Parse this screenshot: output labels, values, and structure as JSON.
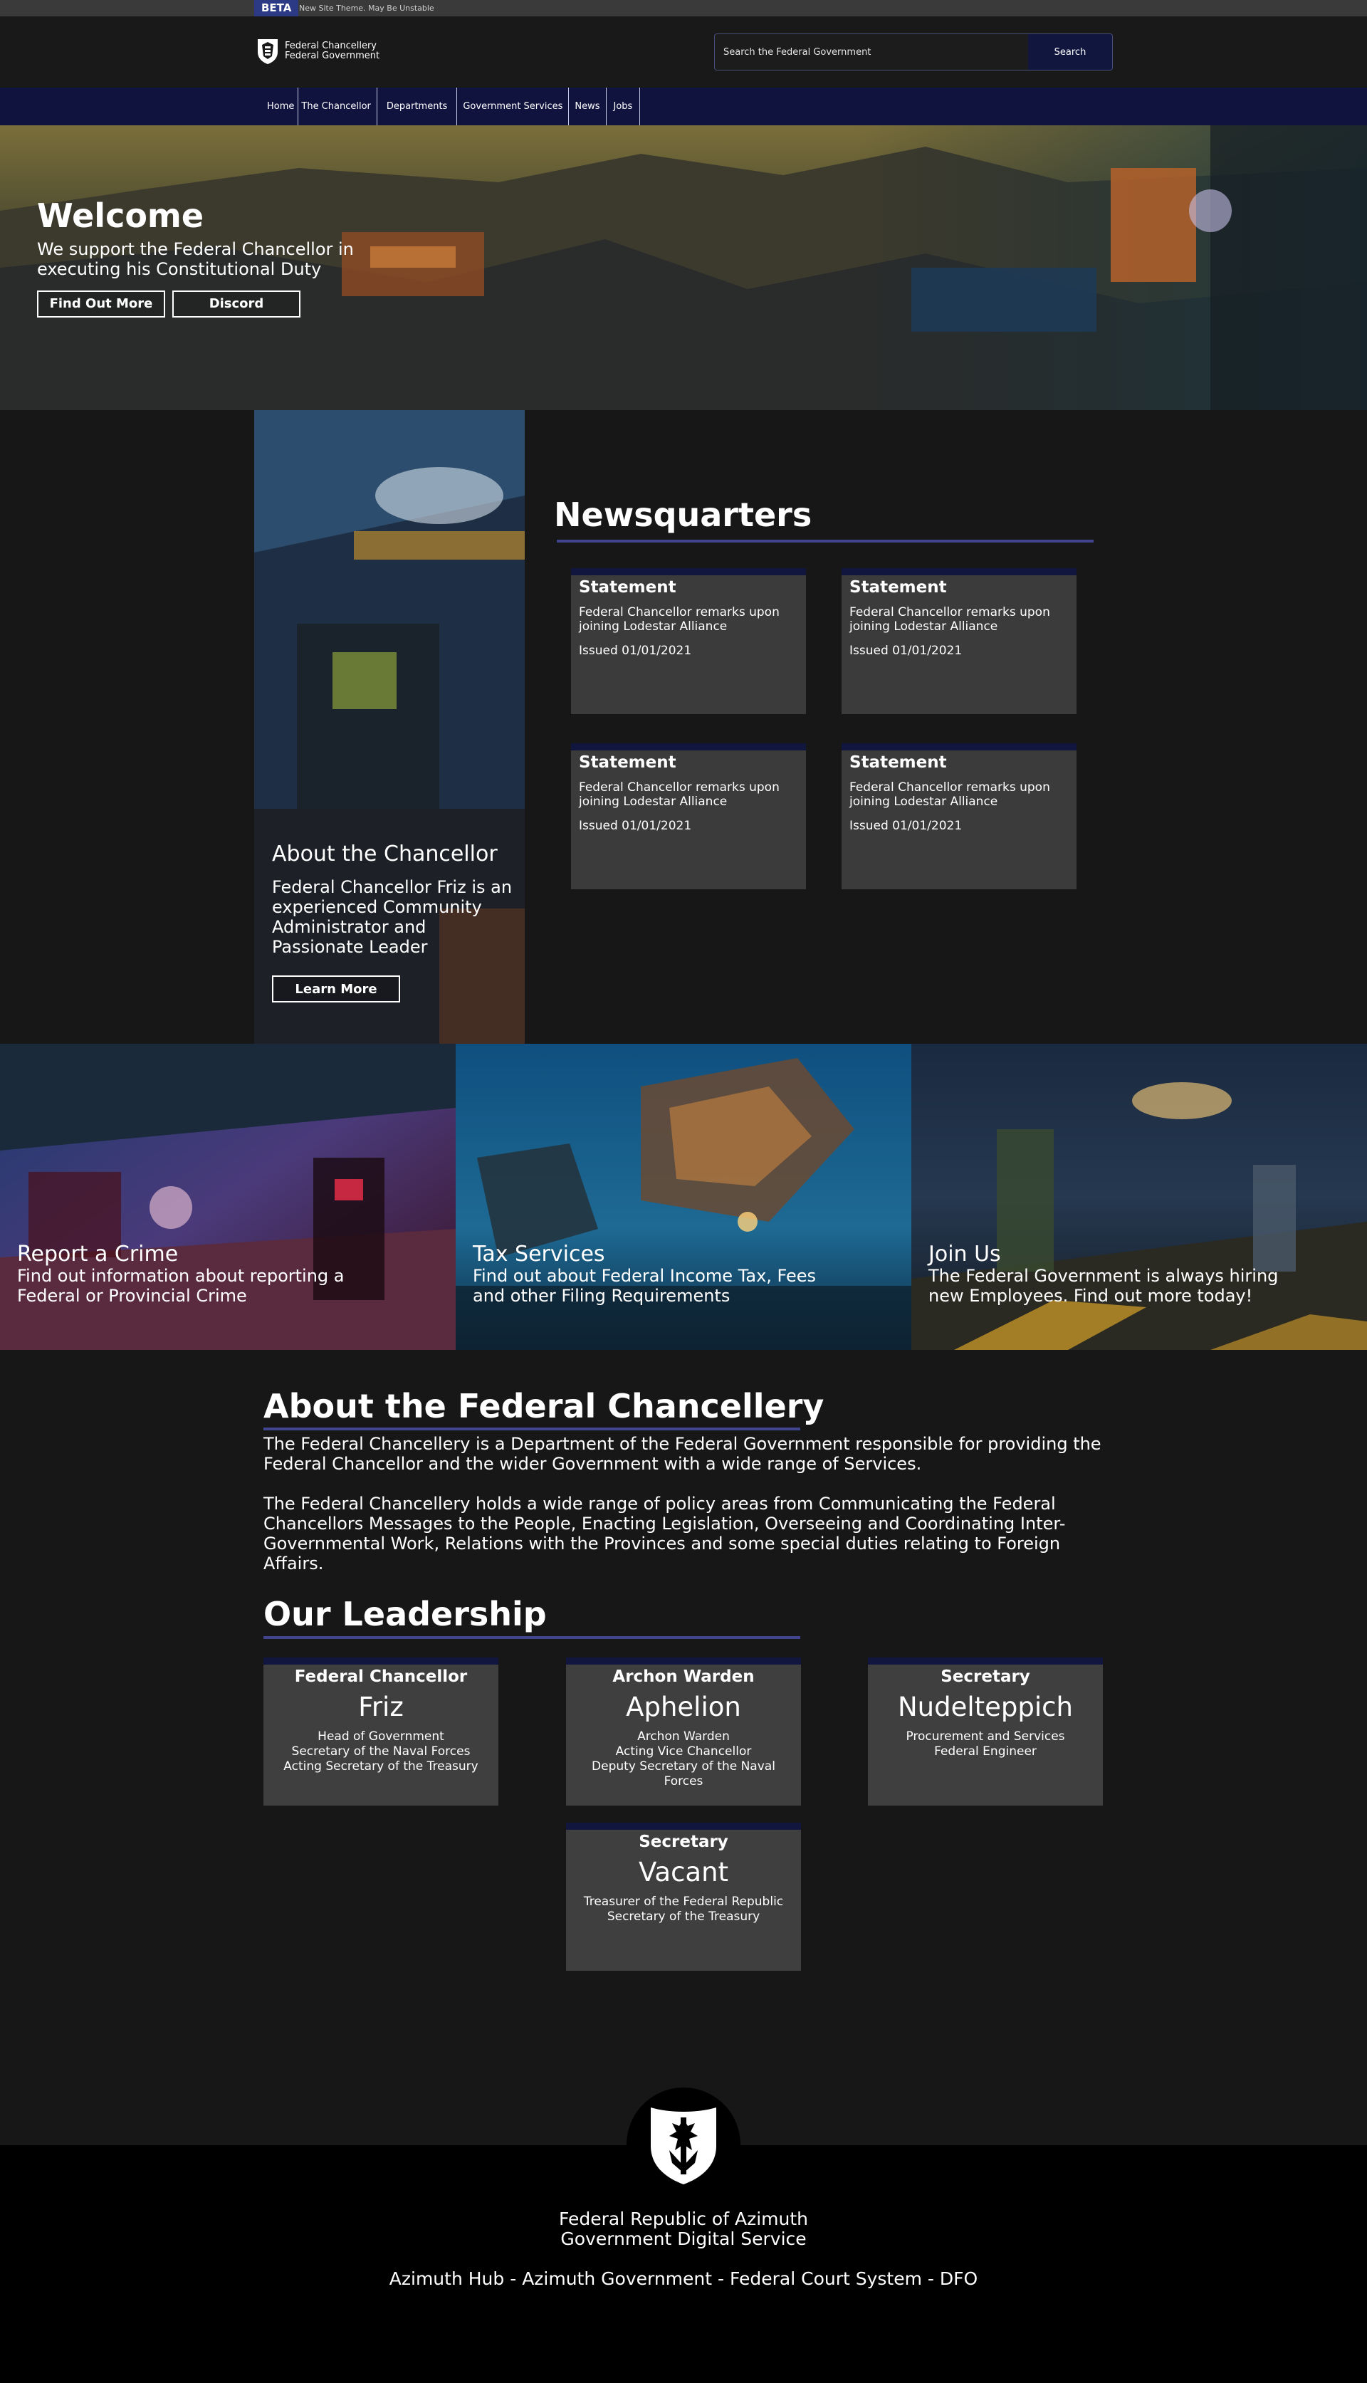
{
  "beta": {
    "tag": "BETA",
    "text": "New Site Theme. May Be Unstable"
  },
  "header": {
    "logo_line1": "Federal Chancellery",
    "logo_line2": "Federal Government",
    "search_placeholder": "Search the Federal Government",
    "search_button": "Search"
  },
  "nav": {
    "items": [
      {
        "label": "Home"
      },
      {
        "label": "The Chancellor"
      },
      {
        "label": "Departments"
      },
      {
        "label": "Government Services"
      },
      {
        "label": "News"
      },
      {
        "label": "Jobs"
      }
    ]
  },
  "hero": {
    "title": "Welcome",
    "subtitle": "We support the Federal Chancellor in executing his Constitutional Duty",
    "button1": "Find Out More",
    "button2": "Discord"
  },
  "chancellor": {
    "title": "About the Chancellor",
    "text": "Federal Chancellor Friz is an experienced Community Administrator and Passionate Leader",
    "button": "Learn More"
  },
  "news": {
    "title": "Newsquarters",
    "cards": [
      {
        "label": "Statement",
        "body": "Federal Chancellor remarks upon joining Lodestar Alliance",
        "date": "Issued 01/01/2021"
      },
      {
        "label": "Statement",
        "body": "Federal Chancellor remarks upon joining Lodestar Alliance",
        "date": "Issued 01/01/2021"
      },
      {
        "label": "Statement",
        "body": "Federal Chancellor remarks upon joining Lodestar Alliance",
        "date": "Issued 01/01/2021"
      },
      {
        "label": "Statement",
        "body": "Federal Chancellor remarks upon joining Lodestar Alliance",
        "date": "Issued 01/01/2021"
      }
    ]
  },
  "tiles": [
    {
      "title": "Report a Crime",
      "text": "Find out information about reporting a Federal or Provincial Crime"
    },
    {
      "title": "Tax Services",
      "text": "Find out about Federal Income Tax, Fees and other Filing Requirements"
    },
    {
      "title": "Join Us",
      "text": "The Federal Government is always hiring new Employees. Find out more today!"
    }
  ],
  "about": {
    "title": "About the Federal Chancellery",
    "p1": "The Federal Chancellery is a Department of the Federal Government responsible for providing the Federal Chancellor and the wider Government with a wide range of Services.",
    "p2": "The Federal Chancellery holds a wide range of policy areas from Communicating the Federal Chancellors Messages to the People, Enacting Legislation, Overseeing and Coordinating Inter-Governmental Work, Relations with the Provinces and some special duties relating to Foreign Affairs."
  },
  "leadership": {
    "title": "Our Leadership",
    "cards": [
      {
        "role": "Federal Chancellor",
        "name": "Friz",
        "duties": [
          "Head of Government",
          "Secretary of the Naval Forces",
          "Acting Secretary of the Treasury"
        ]
      },
      {
        "role": "Archon Warden",
        "name": "Aphelion",
        "duties": [
          "Archon Warden",
          "Acting Vice Chancellor",
          "Deputy Secretary of the Naval Forces"
        ]
      },
      {
        "role": "Secretary",
        "name": "Nudelteppich",
        "duties": [
          "Procurement and Services",
          "Federal Engineer"
        ]
      },
      {
        "role": "Secretary",
        "name": "Vacant",
        "duties": [
          "Treasurer of the Federal Republic",
          "Secretary of the Treasury"
        ]
      }
    ]
  },
  "footer": {
    "line1": "Federal Republic of Azimuth",
    "line2": "Government Digital Service",
    "links": [
      "Azimuth Hub",
      "Azimuth Government",
      "Federal Court System",
      "DFO"
    ],
    "separator": " - "
  },
  "colors": {
    "accent": "#40458e",
    "navy": "#11163f",
    "card": "#3b3b3b",
    "background": "#171717"
  }
}
